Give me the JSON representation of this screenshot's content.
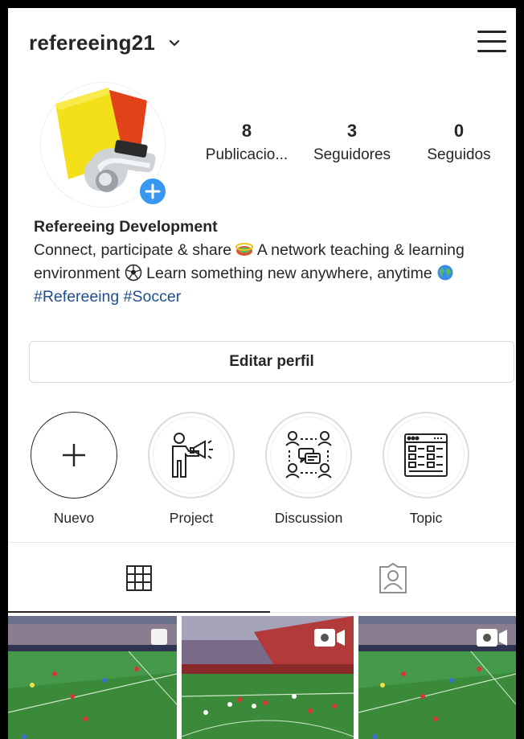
{
  "header": {
    "username": "refereeing21",
    "icons": {
      "dropdown": "chevron-down-icon",
      "menu": "hamburger-menu-icon"
    }
  },
  "stats": [
    {
      "value": "8",
      "label": "Publicacio..."
    },
    {
      "value": "3",
      "label": "Seguidores"
    },
    {
      "value": "0",
      "label": "Seguidos"
    }
  ],
  "bio": {
    "name": "Refereeing Development",
    "text_1": "Connect, participate & share ",
    "text_2": " A network teaching & learning environment ",
    "text_3": " Learn something new anywhere, anytime ",
    "hashtag_1": "#Refereeing",
    "hashtag_2": "#Soccer"
  },
  "edit_button": {
    "label": "Editar perfil"
  },
  "highlights": [
    {
      "label": "Nuevo",
      "icon": "plus-icon"
    },
    {
      "label": "Project",
      "icon": "megaphone-person-icon"
    },
    {
      "label": "Discussion",
      "icon": "discussion-group-icon"
    },
    {
      "label": "Topic",
      "icon": "browser-list-icon"
    }
  ],
  "tabs": [
    {
      "icon": "grid-icon",
      "active": true
    },
    {
      "icon": "tagged-person-icon",
      "active": false
    }
  ],
  "posts": [
    {
      "type": "multiple",
      "badge_icon": "carousel-icon"
    },
    {
      "type": "video",
      "badge_icon": "video-icon"
    },
    {
      "type": "video",
      "badge_icon": "video-icon"
    }
  ],
  "colors": {
    "accent": "#3897f0",
    "hashtag": "#1e4f8c",
    "pitch": "#3a8a3a",
    "text": "#262626"
  }
}
